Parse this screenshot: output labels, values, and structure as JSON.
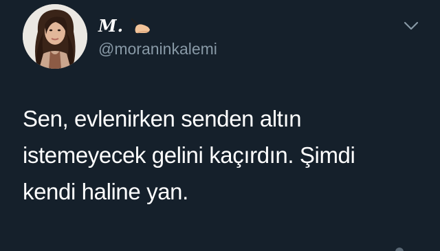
{
  "tweet": {
    "author": {
      "display_name": "M.",
      "handle": "@moraninkalemi",
      "avatar_icon": "profile-photo",
      "name_emoji_icon": "writing-hand-icon"
    },
    "menu_icon": "chevron-down-icon",
    "text_lines": [
      "Sen, evlenirken senden altın",
      "istemeyecek gelini kaçırdın. Şimdi",
      "kendi haline yan."
    ]
  },
  "colors": {
    "background": "#15202b",
    "text_primary": "#ffffff",
    "text_secondary": "#8899a6"
  }
}
